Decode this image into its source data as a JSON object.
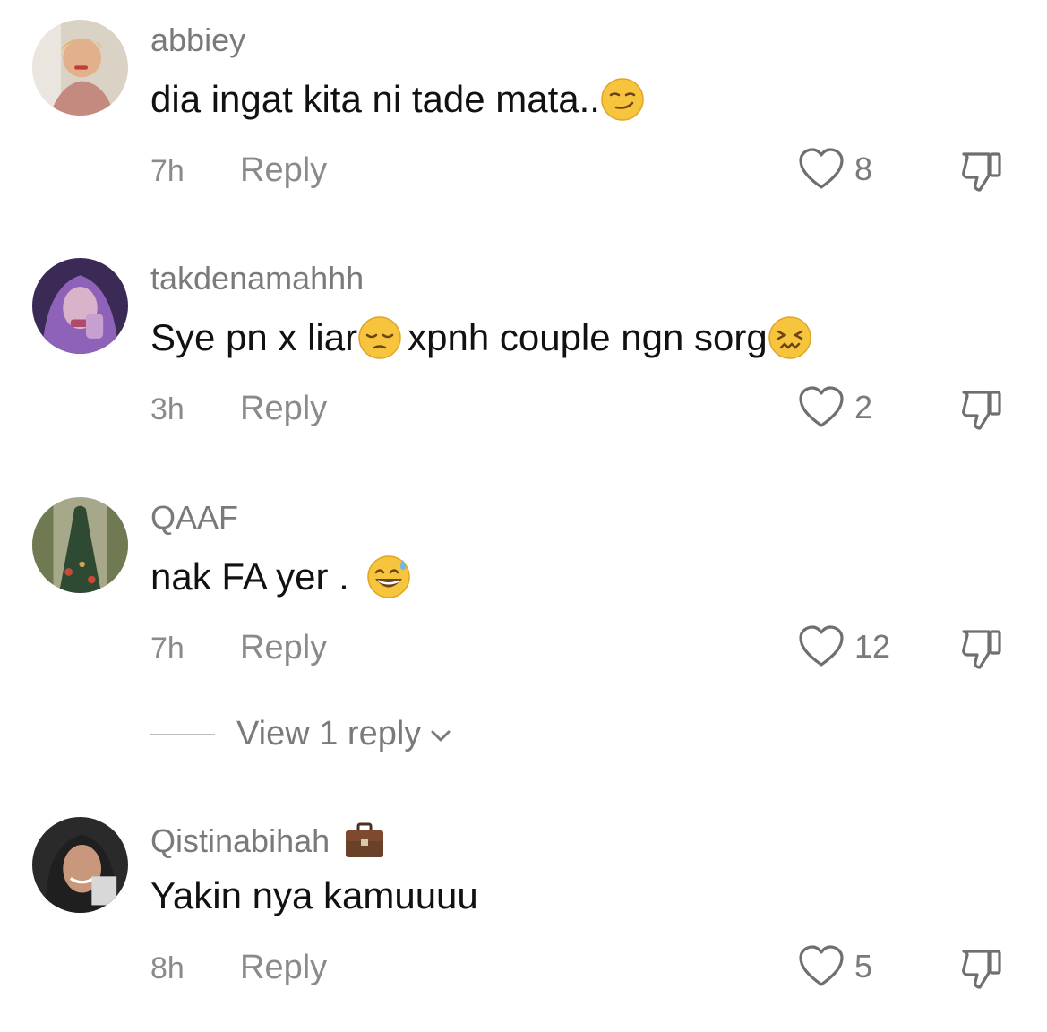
{
  "comments": [
    {
      "username": "abbiey",
      "text": "dia ingat kita ni tade mata..",
      "emoji_after": "smirk-emoji",
      "time": "7h",
      "reply_label": "Reply",
      "likes": "8"
    },
    {
      "username": "takdenamahhh",
      "text_part1": "Sye pn x liar ",
      "emoji_middle": "pensive-emoji",
      "text_part2": "xpnh couple ngn sorg",
      "emoji_after": "confounded-emoji",
      "time": "3h",
      "reply_label": "Reply",
      "likes": "2"
    },
    {
      "username": "QAAF",
      "text": "nak FA yer . ",
      "emoji_after": "grinning-sweat-emoji",
      "time": "7h",
      "reply_label": "Reply",
      "likes": "12",
      "view_replies_label": "View 1 reply"
    },
    {
      "username": "Qistinabihah",
      "username_badge": "briefcase-emoji",
      "text": "Yakin nya kamuuuu",
      "time": "8h",
      "reply_label": "Reply",
      "likes": "5"
    }
  ],
  "colors": {
    "username": "#7a7a7a",
    "text": "#111111",
    "meta": "#8a8a8a",
    "emoji_yellow": "#f7c53d"
  }
}
